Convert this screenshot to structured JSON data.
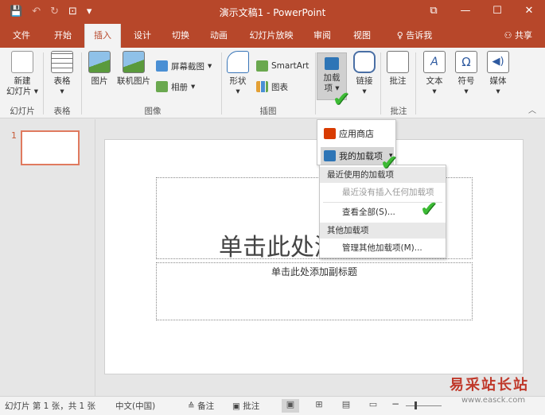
{
  "window": {
    "title": "演示文稿1 - PowerPoint",
    "qat": {
      "save_icon": "save-icon",
      "undo_icon": "undo-icon",
      "redo_icon": "redo-icon",
      "present_icon": "present-icon",
      "customize_icon": "chevron-down-icon"
    },
    "controls": {
      "restore": "⧉",
      "minimize": "—",
      "maximize": "☐",
      "close": "✕"
    }
  },
  "tabs": [
    {
      "label": "文件"
    },
    {
      "label": "开始"
    },
    {
      "label": "插入"
    },
    {
      "label": "设计"
    },
    {
      "label": "切换"
    },
    {
      "label": "动画"
    },
    {
      "label": "幻灯片放映"
    },
    {
      "label": "审阅"
    },
    {
      "label": "视图"
    },
    {
      "label": "告诉我"
    }
  ],
  "active_tab": "插入",
  "share_label": "共享",
  "ribbon": {
    "new_slide": "新建",
    "new_slide_2": "幻灯片",
    "table": "表格",
    "picture": "图片",
    "online_picture": "联机图片",
    "screenshot": "屏幕截图",
    "album": "相册",
    "shapes": "形状",
    "smartart": "SmartArt",
    "chart": "图表",
    "addins": "加载",
    "addins_2": "项",
    "links": "链接",
    "comment": "批注",
    "text": "文本",
    "symbols": "符号",
    "media": "媒体",
    "groups": {
      "slides": "幻灯片",
      "tables": "表格",
      "images": "图像",
      "illustrations": "插图",
      "comments": "批注"
    }
  },
  "addins_menu": {
    "store": "应用商店",
    "my_addins": "我的加载项",
    "recent_header": "最近使用的加载项",
    "recent_empty": "最近没有插入任何加载项",
    "see_all": "查看全部(S)...",
    "other_header": "其他加载项",
    "manage_other": "管理其他加载项(M)..."
  },
  "thumbnails": {
    "slide_number": "1"
  },
  "slide": {
    "title_placeholder": "单击此处添加标题",
    "subtitle_placeholder": "单击此处添加副标题"
  },
  "status": {
    "slide_info": "幻灯片 第 1 张，共 1 张",
    "language": "中文(中国)",
    "notes": "备注",
    "comments": "批注"
  },
  "watermark": "易采站长站",
  "watermark_url": "www.easck.com",
  "colors": {
    "brand": "#b7472a",
    "check": "#3dbb35"
  }
}
